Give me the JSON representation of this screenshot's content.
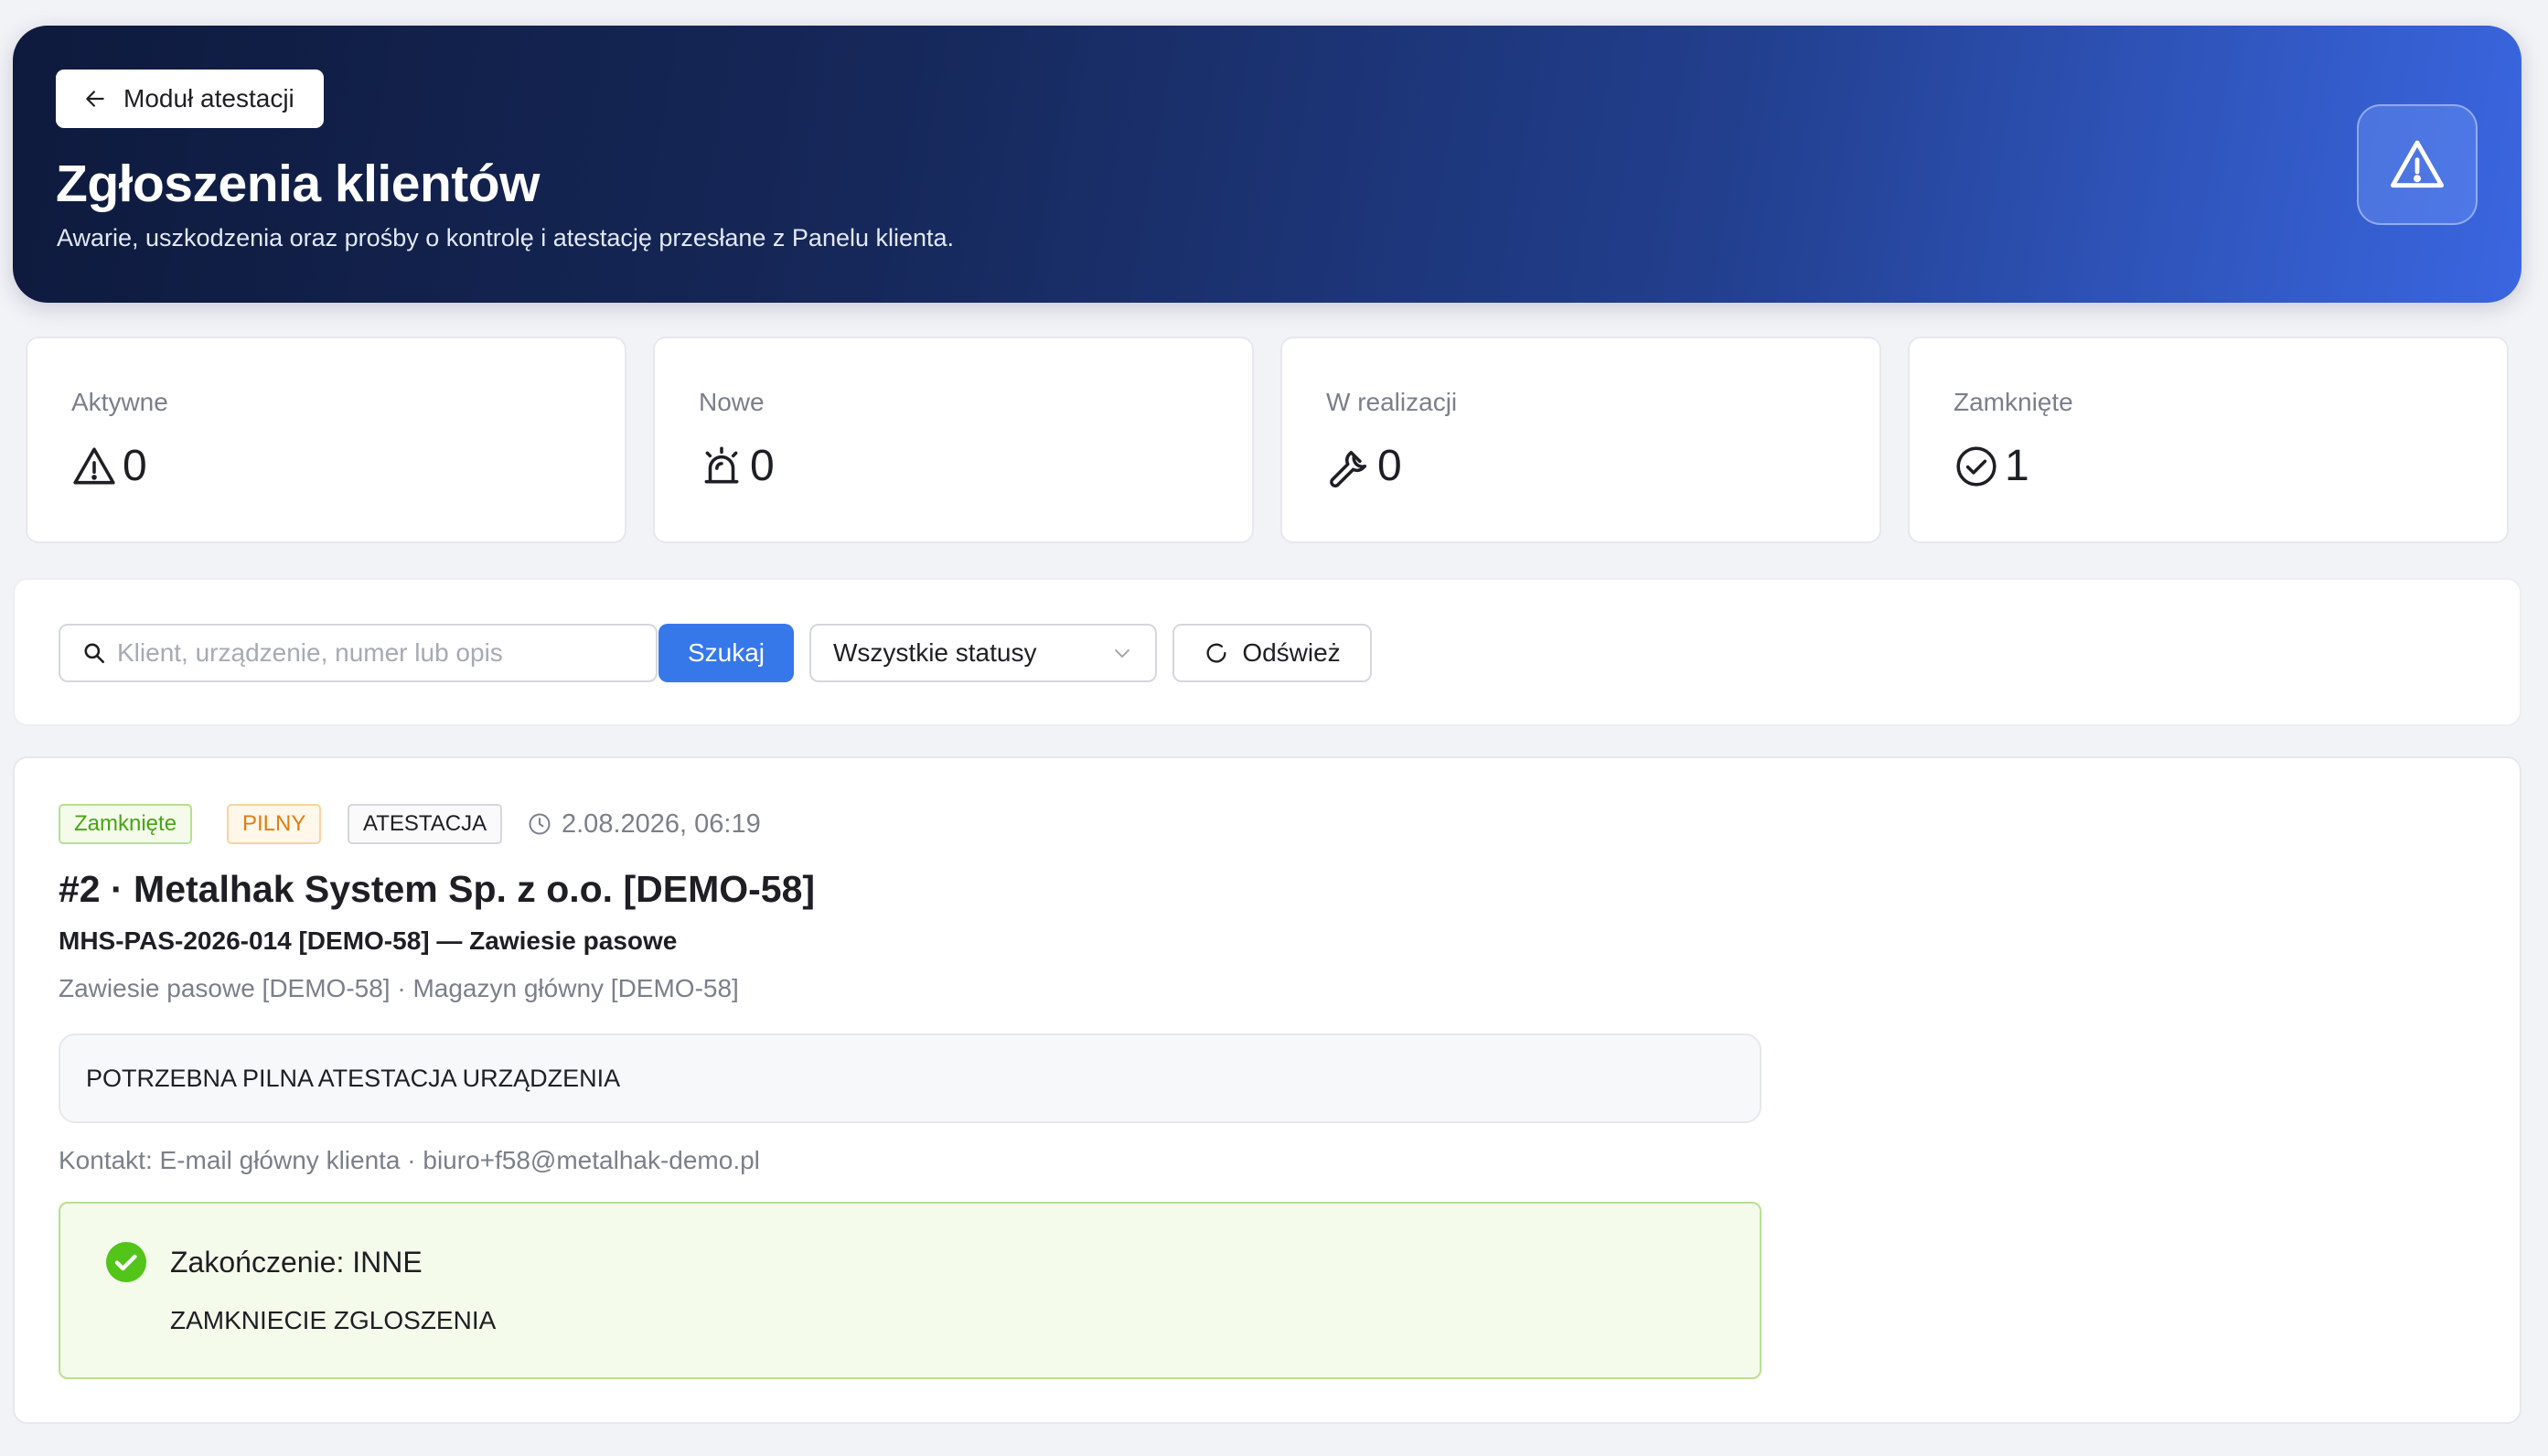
{
  "header": {
    "back_label": "Moduł atestacji",
    "title": "Zgłoszenia klientów",
    "subtitle": "Awarie, uszkodzenia oraz prośby o kontrolę i atestację przesłane z Panelu klienta.",
    "badge_icon": "warning-triangle-icon"
  },
  "stats": [
    {
      "label": "Aktywne",
      "value": "0",
      "icon": "warning-triangle-icon"
    },
    {
      "label": "Nowe",
      "value": "0",
      "icon": "siren-icon"
    },
    {
      "label": "W realizacji",
      "value": "0",
      "icon": "wrench-icon"
    },
    {
      "label": "Zamknięte",
      "value": "1",
      "icon": "check-circle-icon"
    }
  ],
  "filters": {
    "search_placeholder": "Klient, urządzenie, numer lub opis",
    "search_value": "",
    "search_button": "Szukaj",
    "status_selected": "Wszystkie statusy",
    "refresh_button": "Odśwież"
  },
  "ticket": {
    "status_tag": "Zamknięte",
    "priority_tag": "PILNY",
    "type_tag": "ATESTACJA",
    "datetime": "2.08.2026, 06:19",
    "title": "#2 · Metalhak System Sp. z o.o. [DEMO-58]",
    "device": "MHS-PAS-2026-014 [DEMO-58] — Zawiesie pasowe",
    "location": "Zawiesie pasowe [DEMO-58] · Magazyn główny [DEMO-58]",
    "description": "POTRZEBNA PILNA ATESTACJA URZĄDZENIA",
    "contact": "Kontakt: E-mail główny klienta · biuro+f58@metalhak-demo.pl",
    "resolution_title": "Zakończenie: INNE",
    "resolution_note": "ZAMKNIECIE ZGLOSZENIA"
  },
  "colors": {
    "primary": "#3677ea",
    "success": "#47a413",
    "warning": "#e07d10",
    "hero_dark": "#0e1a3d",
    "hero_light": "#3a66e0"
  }
}
